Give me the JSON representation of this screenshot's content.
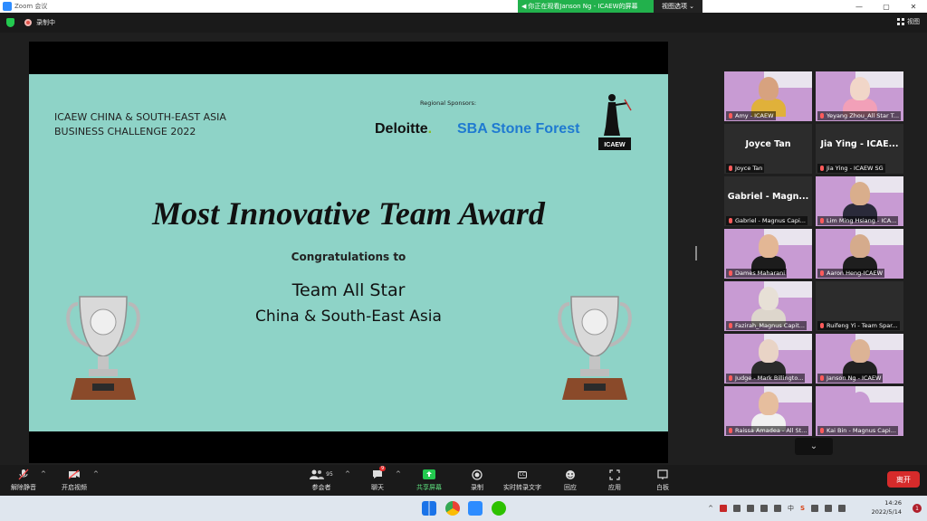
{
  "window": {
    "title": "Zoom 会议",
    "viewing_banner": "你正在观看Janson Ng - ICAEW的屏幕",
    "view_options": "视图选项 ⌄",
    "controls": [
      "—",
      "▢",
      "✕"
    ]
  },
  "meeting_bar": {
    "recording_label": "录制中",
    "view_label": "视图"
  },
  "slide": {
    "event_title_line1": "ICAEW CHINA & SOUTH-EAST ASIA",
    "event_title_line2": "BUSINESS CHALLENGE 2022",
    "sponsor_label": "Regional Sponsors:",
    "sponsor1": "Deloitte",
    "sponsor1_dot": ".",
    "sponsor2": "SBA Stone Forest",
    "icaew_logo_text": "ICAEW",
    "award_title": "Most Innovative Team Award",
    "congrats": "Congratulations to",
    "team_name": "Team All Star",
    "team_region": "China & South-East Asia"
  },
  "participants": [
    {
      "name": "Amy - ICAEW",
      "video": true,
      "active": true,
      "skin": "#d7a27f",
      "shirt": "#e0b13a"
    },
    {
      "name": "Yeyang Zhou_All Star T...",
      "video": true,
      "skin": "#f1d6c8",
      "shirt": "#f2a0b8"
    },
    {
      "name": "Joyce Tan",
      "video": false,
      "display": "Joyce Tan"
    },
    {
      "name": "Jia Ying - ICAEW SG",
      "video": false,
      "display": "Jia Ying - ICAE..."
    },
    {
      "name": "Gabriel - Magnus Capi...",
      "video": false,
      "display": "Gabriel - Magn..."
    },
    {
      "name": "Lim Ming Hsiang - ICA...",
      "video": true,
      "skin": "#d9ae8c",
      "shirt": "#2a2a3a"
    },
    {
      "name": "Dames Maharani",
      "video": true,
      "skin": "#e3b795",
      "shirt": "#1c1c1c"
    },
    {
      "name": "Aaron Heng-ICAEW",
      "video": true,
      "skin": "#d5ab8c",
      "shirt": "#1e1e1e"
    },
    {
      "name": "Fazirah_Magnus Capit...",
      "video": true,
      "skin": "#e7e0d6",
      "shirt": "#ddd6cc"
    },
    {
      "name": "Ruifeng Yi - Team Spar...",
      "video": false,
      "display": ""
    },
    {
      "name": "Judge - Mark Billingto...",
      "video": true,
      "skin": "#e9d4c6",
      "shirt": "#2b2b2b"
    },
    {
      "name": "Janson Ng - ICAEW",
      "video": true,
      "skin": "#dcb395",
      "shirt": "#222222"
    },
    {
      "name": "Raissa Amadea - All St...",
      "video": true,
      "skin": "#e6be9e",
      "shirt": "#f1f1f1"
    },
    {
      "name": "Kai Bin - Magnus Capi...",
      "video": true,
      "skin": "#c89bd3",
      "shirt": "#c89bd3"
    }
  ],
  "toolbar": {
    "unmute": "解除静音",
    "start_video": "开启视频",
    "participants": "参会者",
    "participants_count": "95",
    "chat": "聊天",
    "chat_badge": "9",
    "share_screen": "共享屏幕",
    "record": "录制",
    "live_transcript": "实时转录文字",
    "cc_icon": "CC",
    "reactions": "回应",
    "apps": "应用",
    "whiteboard": "白板",
    "leave": "离开",
    "caret": "^"
  },
  "taskbar": {
    "time": "14:26",
    "date": "2022/5/14",
    "notifications": "1",
    "ime_cn": "中",
    "ime_s": "S"
  },
  "colors": {
    "slide_bg": "#8ed3c7",
    "banner_green": "#22b14c",
    "leave_red": "#d62b2b",
    "tile_purple": "#c89bd3"
  }
}
